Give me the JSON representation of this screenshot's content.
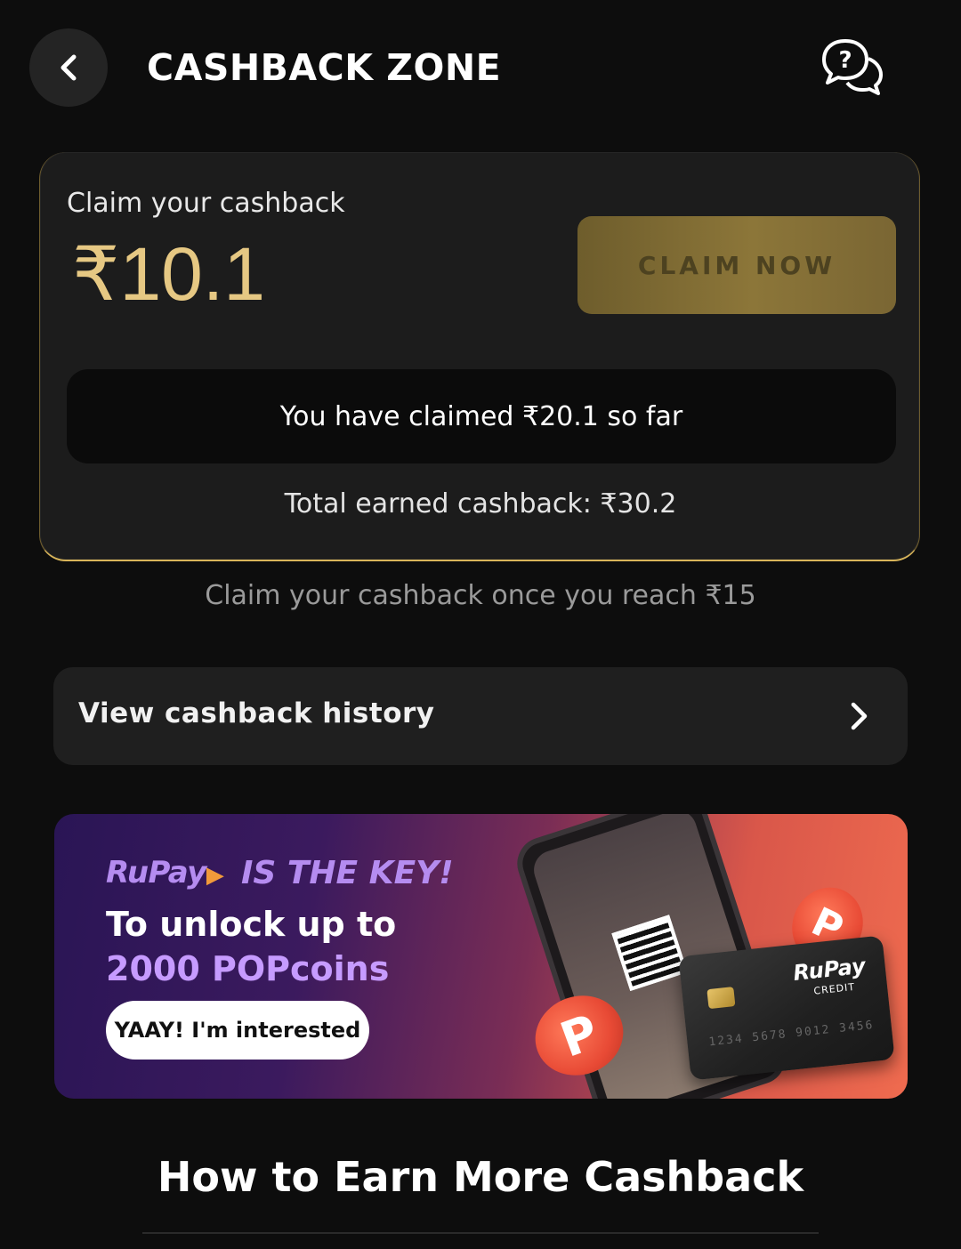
{
  "header": {
    "title": "CASHBACK ZONE",
    "back_icon": "chevron-left-icon",
    "help_icon": "help-chat-icon"
  },
  "claim_card": {
    "label": "Claim your cashback",
    "amount": "₹10.1",
    "claim_button": "CLAIM NOW",
    "claimed_text": "You have claimed ₹20.1 so far",
    "total_earned": "Total earned cashback: ₹30.2"
  },
  "reach_note": "Claim your cashback once you reach ₹15",
  "history": {
    "label": "View cashback history",
    "icon": "chevron-right-icon"
  },
  "banner": {
    "brand": "RuPay",
    "tagline": "IS THE KEY!",
    "line1": "To unlock up to",
    "line2": "2000 POPcoins",
    "button": "YAAY! I'm interested",
    "card_brand": "RuPay",
    "card_type": "CREDIT",
    "card_number": "1234 5678 9012 3456"
  },
  "section_heading": "How to Earn More Cashback",
  "colors": {
    "background": "#0d0d0d",
    "accent_gold": "#e6c883",
    "claim_button_bg": "#8c7639",
    "banner_purple": "#2a1555",
    "banner_orange": "#ef6b4f"
  }
}
